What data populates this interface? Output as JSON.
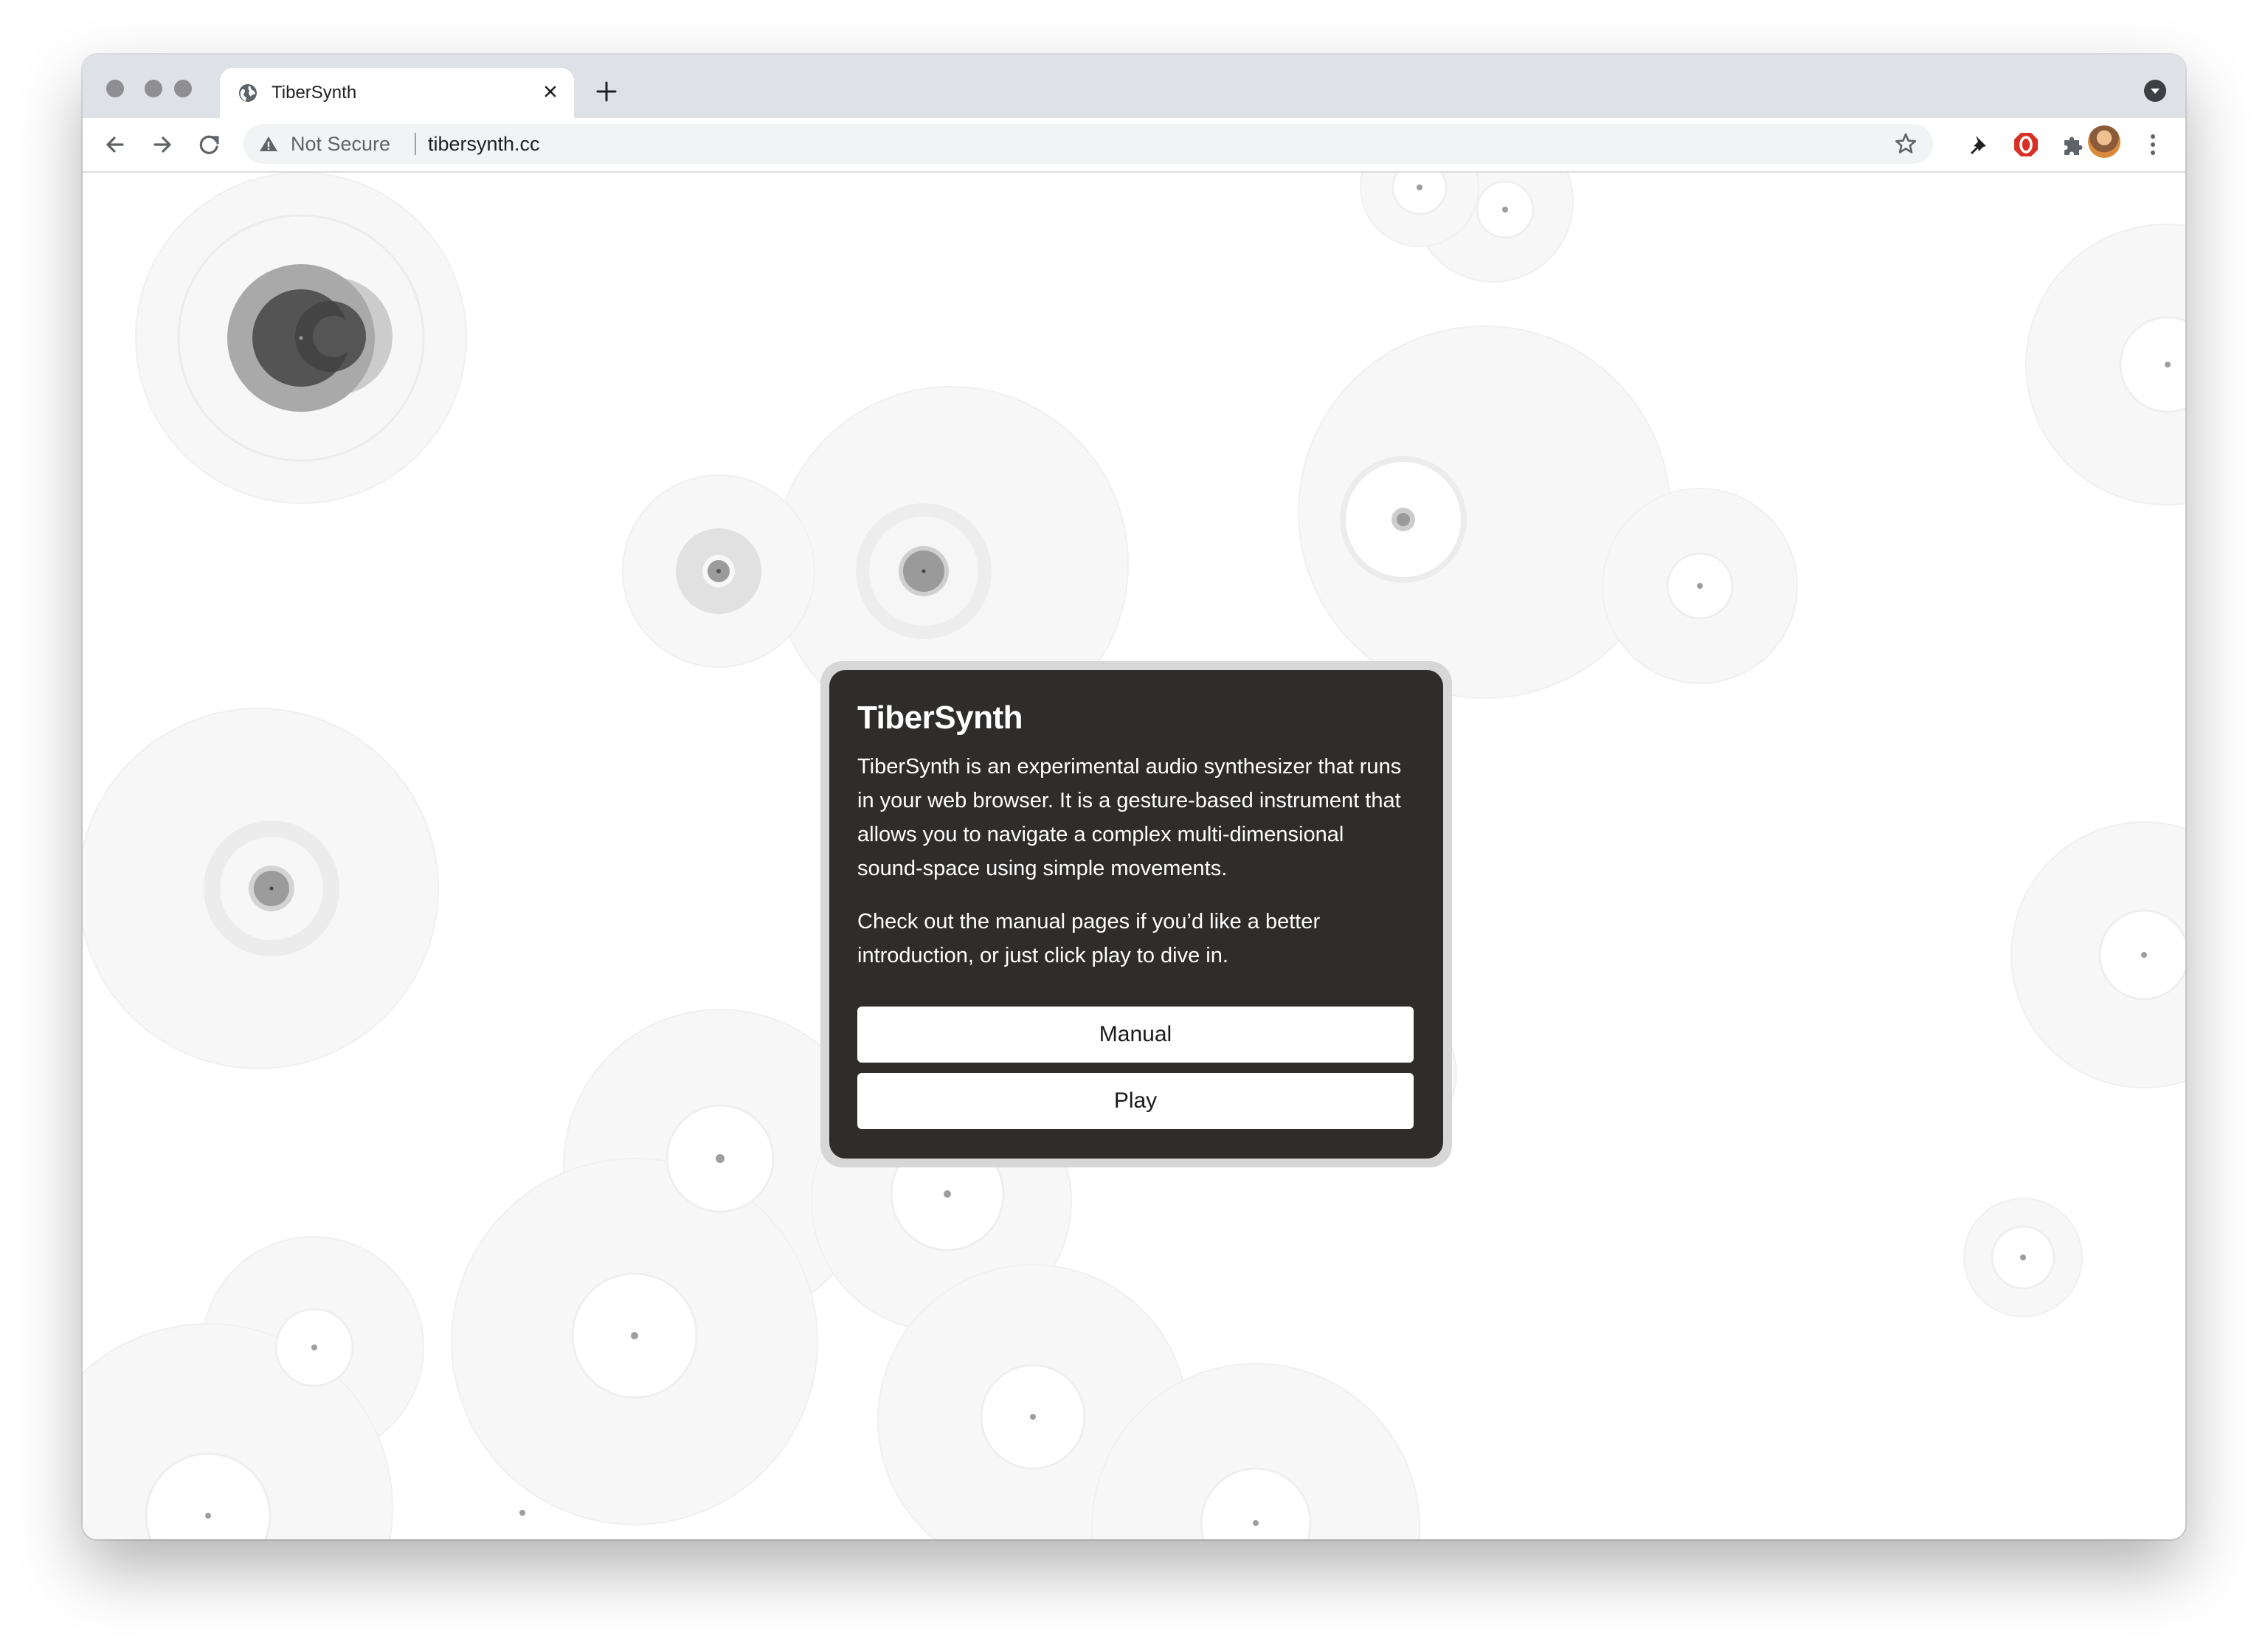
{
  "browser": {
    "tab": {
      "title": "TiberSynth",
      "favicon": "globe-icon"
    },
    "address_bar": {
      "security_label": "Not Secure",
      "url": "tibersynth.cc"
    },
    "toolbar_icons": [
      "back-icon",
      "forward-icon",
      "reload-icon",
      "bookmark-star-icon",
      "pin-extension-icon",
      "adblock-extension-icon",
      "extensions-puzzle-icon",
      "profile-avatar",
      "menu-kebab-icon"
    ]
  },
  "modal": {
    "title": "TiberSynth",
    "paragraphs": [
      [
        "TiberSynth is an experimental audio synthesizer that runs",
        "in your web browser. It is a gesture-based instrument that",
        "allows you to navigate a complex multi-dimensional",
        "sound-space using simple movements."
      ],
      [
        "Check out the manual pages if you’d like a better",
        "introduction, or just click play to dive in."
      ]
    ],
    "buttons": {
      "manual": "Manual",
      "play": "Play"
    }
  },
  "colors": {
    "modal_background": "#2e2d2c",
    "modal_border": "#d7d7d7",
    "button_background": "#ffffff",
    "tabstrip": "#dee1e6",
    "warning_red": "#d93025"
  }
}
